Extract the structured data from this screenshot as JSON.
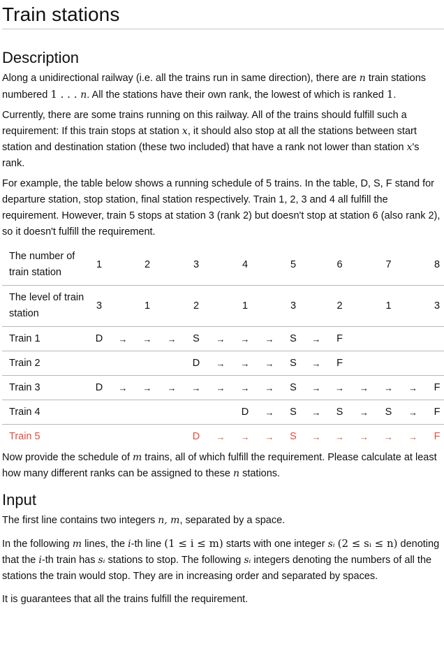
{
  "title": "Train stations",
  "sections": {
    "description": {
      "heading": "Description",
      "p1": {
        "a": "Along a unidirectional railway (i.e. all the trains run in same direction), there are ",
        "var_n": "n",
        "b": " train stations numbered ",
        "range": "1 . . . ",
        "var_n2": "n",
        "c": ". All the stations have their own rank, the lowest of which is ranked ",
        "one": "1",
        "d": "."
      },
      "p2": {
        "a": "Currently, there are some trains running on this railway. All of the trains should fulfill such a requirement: If this train stops at station ",
        "var_x": "x",
        "b": ", it should also stop at all the stations between start station and destination station (these two included) that have a rank not lower than station ",
        "var_x2": "x",
        "c": "'s rank."
      },
      "p3": "For example, the table below shows a running schedule of 5 trains. In the table, D, S, F stand for departure station, stop station, final station respectively. Train 1, 2, 3 and 4 all fulfill the requirement. However, train 5 stops at station 3 (rank 2) but doesn't stop at station 6 (also rank 2), so it doesn't fulfill the requirement.",
      "p4": {
        "a": "Now provide the schedule of ",
        "var_m": "m",
        "b": " trains, all of which fulfill the requirement. Please calculate at least how many different ranks can be assigned to these ",
        "var_n": "n",
        "c": " stations."
      }
    },
    "input": {
      "heading": "Input",
      "p1": {
        "a": "The first line contains two integers ",
        "vars": "n, m",
        "b": ", separated by a space."
      },
      "p2": {
        "a": "In the following ",
        "var_m": "m",
        "b": " lines, the ",
        "var_i": "i",
        "c": "-th line ",
        "cond1": "(1 ≤ i ≤ m)",
        "d": " starts with one integer ",
        "var_si": "sᵢ",
        "e": " ",
        "cond2": "(2 ≤ sᵢ ≤ n)",
        "f": " denoting that the ",
        "var_i2": "i",
        "g": "-th train has ",
        "var_si2": "sᵢ",
        "h": " stations to stop. The following ",
        "var_si3": "sᵢ",
        "k": " integers denoting the numbers of all the stations the train would stop. They are in increasing order and separated by spaces."
      },
      "p3": "It is guarantees that all the trains fulfill the requirement."
    }
  },
  "table": {
    "header_station_label": "The number of train station",
    "header_level_label": "The level of train station",
    "stations": [
      "1",
      "2",
      "3",
      "4",
      "5",
      "6",
      "7",
      "8"
    ],
    "levels": [
      "3",
      "1",
      "2",
      "1",
      "3",
      "2",
      "1",
      "3"
    ],
    "trains": [
      {
        "label": "Train 1",
        "valid": true,
        "cells": [
          "D",
          "→",
          "→",
          "→",
          "S",
          "→",
          "→",
          "→",
          "S",
          "→",
          "F",
          "",
          "",
          "",
          ""
        ]
      },
      {
        "label": "Train 2",
        "valid": true,
        "cells": [
          "",
          "",
          "",
          "",
          "D",
          "→",
          "→",
          "→",
          "S",
          "→",
          "F",
          "",
          "",
          "",
          ""
        ]
      },
      {
        "label": "Train 3",
        "valid": true,
        "cells": [
          "D",
          "→",
          "→",
          "→",
          "→",
          "→",
          "→",
          "→",
          "S",
          "→",
          "→",
          "→",
          "→",
          "→",
          "F"
        ]
      },
      {
        "label": "Train 4",
        "valid": true,
        "cells": [
          "",
          "",
          "",
          "",
          "",
          "",
          "D",
          "→",
          "S",
          "→",
          "S",
          "→",
          "S",
          "→",
          "F"
        ]
      },
      {
        "label": "Train 5",
        "valid": false,
        "cells": [
          "",
          "",
          "",
          "",
          "D",
          "→",
          "→",
          "→",
          "S",
          "→",
          "→",
          "→",
          "→",
          "→",
          "F"
        ]
      }
    ]
  },
  "colors": {
    "invalid_row": "#e74c3c",
    "rule": "#b8b8b8"
  }
}
